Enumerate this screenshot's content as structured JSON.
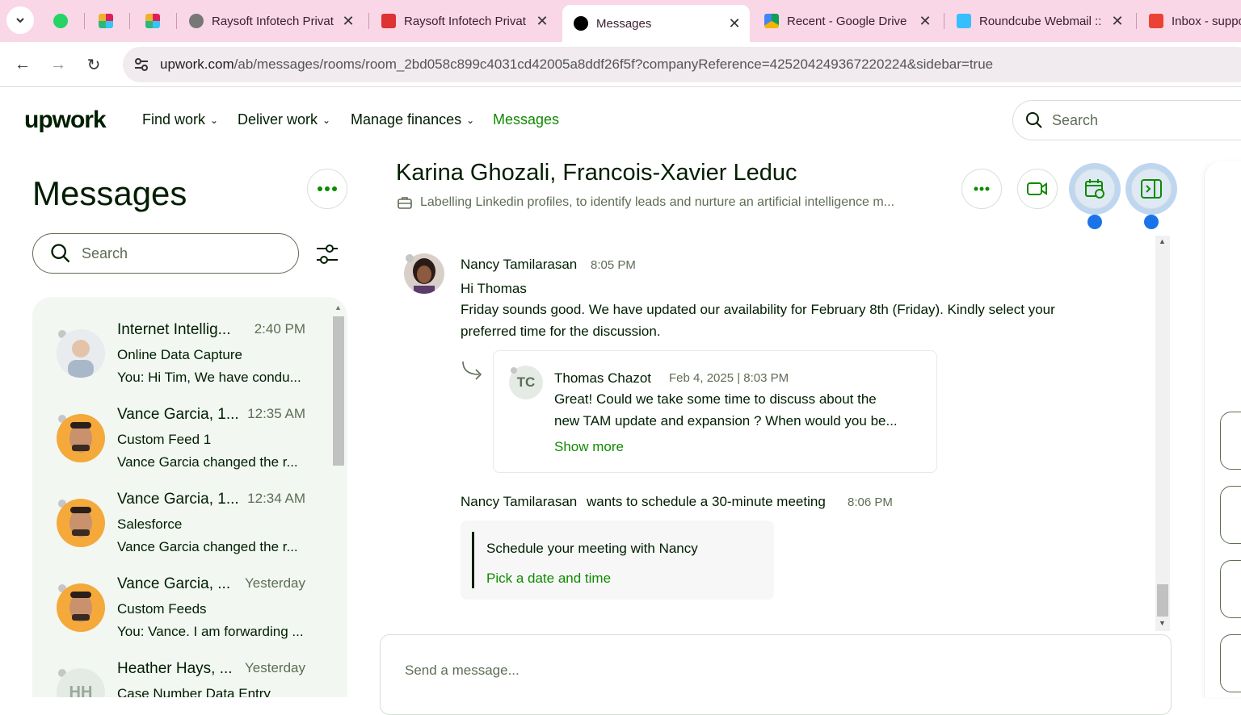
{
  "browser": {
    "tabs": [
      {
        "title": "Raysoft Infotech Privat"
      },
      {
        "title": "Raysoft Infotech Privat"
      },
      {
        "title": "Messages"
      },
      {
        "title": "Recent - Google Drive"
      },
      {
        "title": "Roundcube Webmail ::"
      },
      {
        "title": "Inbox - suppo"
      }
    ],
    "url_host": "upwork.com",
    "url_path": "/ab/messages/rooms/room_2bd058c899c4031cd42005a8ddf26f5f?companyReference=425204249367220224&sidebar=true"
  },
  "header": {
    "logo": "upwork",
    "nav": [
      "Find work",
      "Deliver work",
      "Manage finances",
      "Messages"
    ],
    "search_placeholder": "Search"
  },
  "sidebar": {
    "title": "Messages",
    "search_placeholder": "Search",
    "rooms": [
      {
        "name": "Internet Intellig...",
        "time": "2:40 PM",
        "subject": "Online Data Capture",
        "preview": "You: Hi Tim, We have condu..."
      },
      {
        "name": "Vance Garcia, 1...",
        "time": "12:35 AM",
        "subject": "Custom Feed 1",
        "preview": "Vance Garcia changed the r..."
      },
      {
        "name": "Vance Garcia, 1...",
        "time": "12:34 AM",
        "subject": "Salesforce",
        "preview": "Vance Garcia changed the r..."
      },
      {
        "name": "Vance Garcia, ...",
        "time": "Yesterday",
        "subject": "Custom Feeds",
        "preview": "You: Vance. I am forwarding ..."
      },
      {
        "name": "Heather Hays, ...",
        "time": "Yesterday",
        "subject": "Case Number Data Entry",
        "preview": "",
        "initials": "HH"
      }
    ]
  },
  "conversation": {
    "title": "Karina Ghozali, Francois-Xavier Leduc",
    "subtitle": "Labelling Linkedin profiles, to identify leads and nurture an artificial intelligence m...",
    "message1": {
      "sender": "Nancy Tamilarasan",
      "time": "8:05 PM",
      "line1": "Hi Thomas",
      "line2": "Friday sounds good. We have updated our availability for February 8th (Friday). Kindly select your",
      "line3": "preferred time for the discussion."
    },
    "quoted": {
      "initials": "TC",
      "sender": "Thomas Chazot",
      "time": "Feb 4, 2025 | 8:03 PM",
      "line1": "Great! Could we take some time to discuss about the",
      "line2": "new TAM update and expansion ? When would you be...",
      "show_more": "Show more"
    },
    "meeting": {
      "sender": "Nancy Tamilarasan",
      "text": "wants to schedule a 30-minute meeting",
      "time": "8:06 PM",
      "card_title": "Schedule your meeting with Nancy",
      "card_link": "Pick a date and time"
    },
    "composer_placeholder": "Send a message..."
  },
  "colors": {
    "brand_green": "#108a00",
    "tab_bg": "#f9d7e7",
    "highlight_blue": "#1a73e8"
  }
}
